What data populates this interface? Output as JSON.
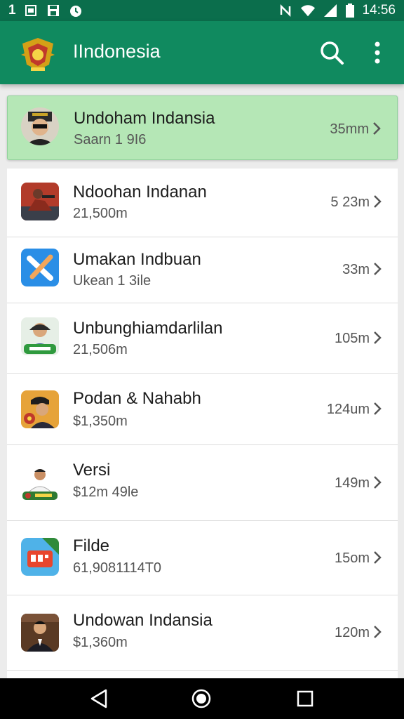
{
  "status_bar": {
    "left_text": "1",
    "left_icons": [
      "sim-card-icon",
      "save-icon",
      "alarm-icon"
    ],
    "right_icons": [
      "nfc-icon",
      "wifi-icon",
      "signal-icon",
      "battery-icon"
    ],
    "time": "14:56"
  },
  "app_bar": {
    "title": "IIndonesia",
    "logo_icon": "garuda-emblem-icon",
    "actions": [
      "search-icon",
      "more-vert-icon"
    ]
  },
  "colors": {
    "status_bar": "#0b6e4c",
    "app_bar": "#108a5f",
    "highlight_row": "#b5e7b6",
    "background": "#ececec"
  },
  "items": [
    {
      "title": "Undoham Indansia",
      "subtitle": "Saarn 1 9I6",
      "size": "35mm",
      "icon": "officer-avatar-icon",
      "highlighted": true
    },
    {
      "title": "Ndoohan Indanan",
      "subtitle": "21,500m",
      "size": "5 23m",
      "icon": "boat-photo-icon"
    },
    {
      "title": "Umakan Indbuan",
      "subtitle": "Ukean 1 3ile",
      "size": "33m",
      "icon": "tools-app-icon"
    },
    {
      "title": "Unbunghiamdarlilan",
      "subtitle": "21,506m",
      "size": "105m",
      "icon": "person-badge-icon"
    },
    {
      "title": "Podan & Nahabh",
      "subtitle": "$1,350m",
      "size": "124um",
      "icon": "captain-avatar-icon"
    },
    {
      "title": "Versi",
      "subtitle": "$12m 49le",
      "size": "149m",
      "icon": "official-avatar-icon"
    },
    {
      "title": "Filde",
      "subtitle": "61,9081114T0",
      "size": "15om",
      "icon": "film-app-icon"
    },
    {
      "title": "Undowan Indansia",
      "subtitle": "$1,360m",
      "size": "120m",
      "icon": "businessman-photo-icon"
    }
  ],
  "nav_bar": [
    "back-icon",
    "home-icon",
    "recents-icon"
  ]
}
